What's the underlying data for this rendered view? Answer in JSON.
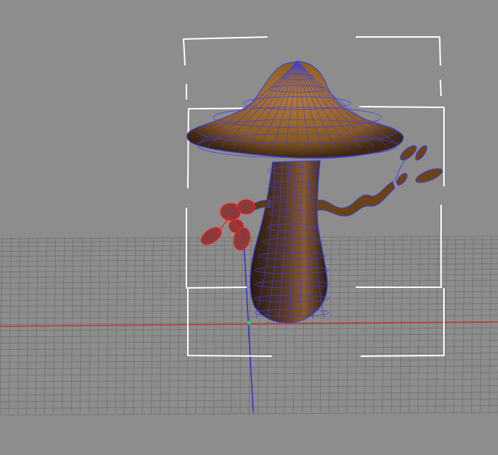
{
  "viewport": {
    "view": "perspective",
    "background_color": "#8d8d8d",
    "grid_color": "#6f6f6f",
    "x_axis_color": "#c83232",
    "y_axis_color": "#2b2bd6",
    "wireframe_color": "#3f3fe0",
    "selected_color": "#ff1a1a",
    "selection_bracket_color": "#ffffff",
    "pivot_color": "#2ee02e"
  },
  "scene": {
    "object": "mushroom",
    "cap_color": "#8a5a22",
    "stem_color": "#4a3020",
    "selected_part": "red-leaf-sprig"
  }
}
